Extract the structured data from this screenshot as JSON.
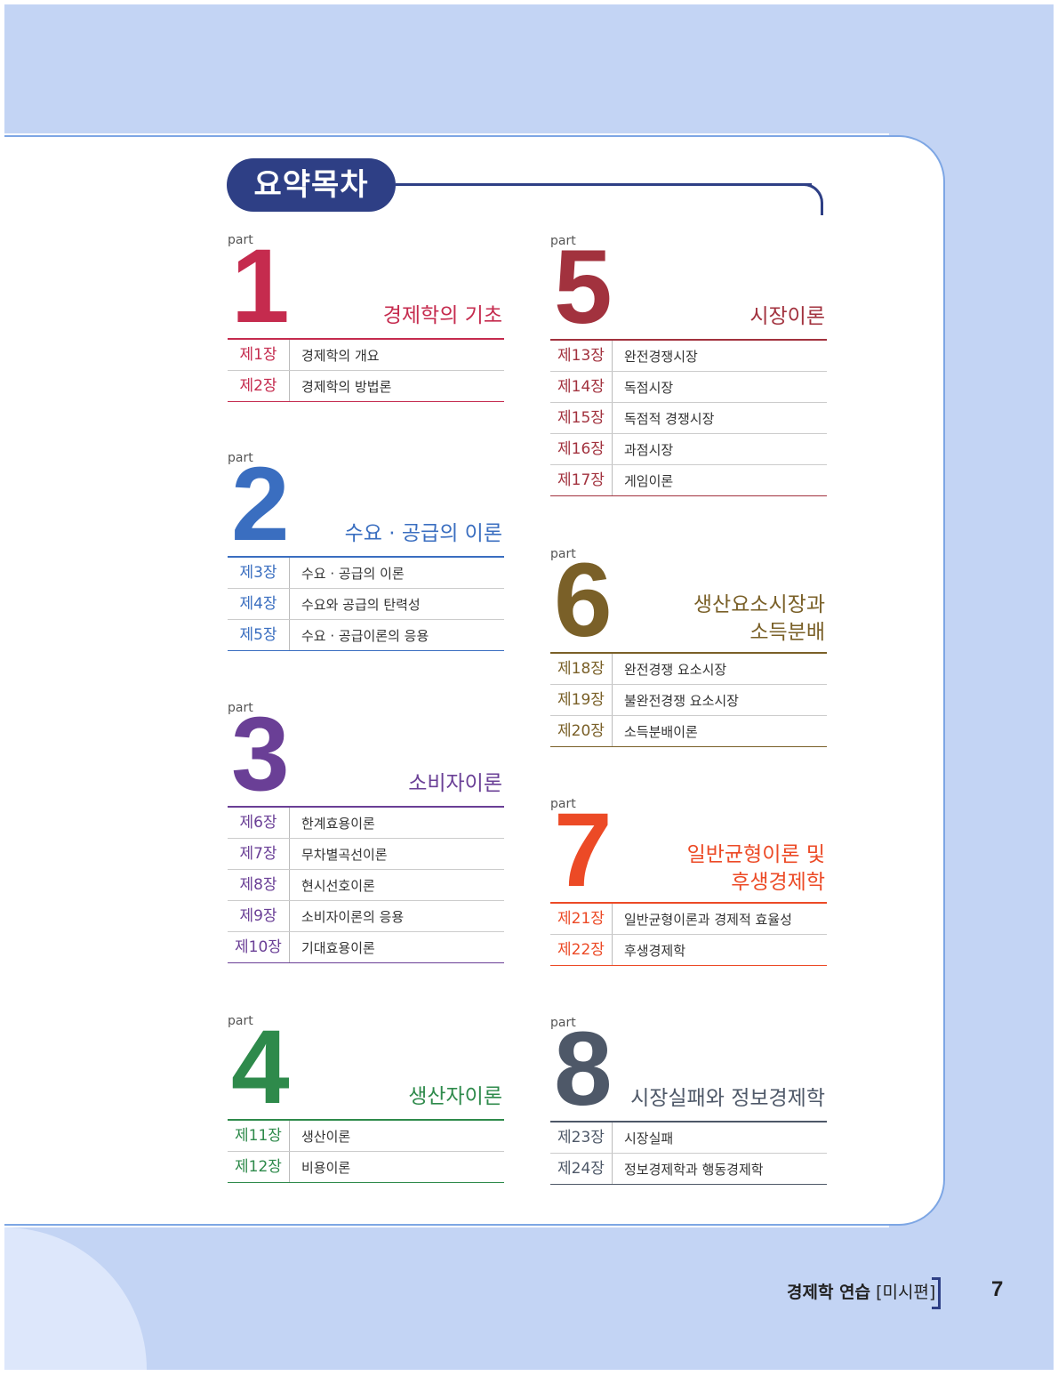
{
  "toc_title": "요약목차",
  "part_word": "part",
  "parts": [
    {
      "num": "1",
      "title": "경제학의 기초",
      "color": "#c52b4e",
      "chapters": [
        {
          "num": "제1장",
          "name": "경제학의 개요"
        },
        {
          "num": "제2장",
          "name": "경제학의 방법론"
        }
      ]
    },
    {
      "num": "2",
      "title": "수요 · 공급의 이론",
      "color": "#3a6ec0",
      "chapters": [
        {
          "num": "제3장",
          "name": "수요 · 공급의 이론"
        },
        {
          "num": "제4장",
          "name": "수요와 공급의 탄력성"
        },
        {
          "num": "제5장",
          "name": "수요 · 공급이론의 응용"
        }
      ]
    },
    {
      "num": "3",
      "title": "소비자이론",
      "color": "#6a3f96",
      "chapters": [
        {
          "num": "제6장",
          "name": "한계효용이론"
        },
        {
          "num": "제7장",
          "name": "무차별곡선이론"
        },
        {
          "num": "제8장",
          "name": "현시선호이론"
        },
        {
          "num": "제9장",
          "name": "소비자이론의 응용"
        },
        {
          "num": "제10장",
          "name": "기대효용이론"
        }
      ]
    },
    {
      "num": "4",
      "title": "생산자이론",
      "color": "#2e8a4b",
      "chapters": [
        {
          "num": "제11장",
          "name": "생산이론"
        },
        {
          "num": "제12장",
          "name": "비용이론"
        }
      ]
    },
    {
      "num": "5",
      "title": "시장이론",
      "color": "#a2323e",
      "chapters": [
        {
          "num": "제13장",
          "name": "완전경쟁시장"
        },
        {
          "num": "제14장",
          "name": "독점시장"
        },
        {
          "num": "제15장",
          "name": "독점적 경쟁시장"
        },
        {
          "num": "제16장",
          "name": "과점시장"
        },
        {
          "num": "제17장",
          "name": "게임이론"
        }
      ]
    },
    {
      "num": "6",
      "title": "생산요소시장과\n소득분배",
      "color": "#7a6028",
      "chapters": [
        {
          "num": "제18장",
          "name": "완전경쟁 요소시장"
        },
        {
          "num": "제19장",
          "name": "불완전경쟁 요소시장"
        },
        {
          "num": "제20장",
          "name": "소득분배이론"
        }
      ]
    },
    {
      "num": "7",
      "title": "일반균형이론 및\n후생경제학",
      "color": "#ec4a26",
      "chapters": [
        {
          "num": "제21장",
          "name": "일반균형이론과 경제적 효율성"
        },
        {
          "num": "제22장",
          "name": "후생경제학"
        }
      ]
    },
    {
      "num": "8",
      "title": "시장실패와 정보경제학",
      "color": "#4e5868",
      "chapters": [
        {
          "num": "제23장",
          "name": "시장실패"
        },
        {
          "num": "제24장",
          "name": "정보경제학과 행동경제학"
        }
      ]
    }
  ],
  "footer": {
    "book": "경제학 연습",
    "edition": "[미시편]",
    "page": "7"
  }
}
